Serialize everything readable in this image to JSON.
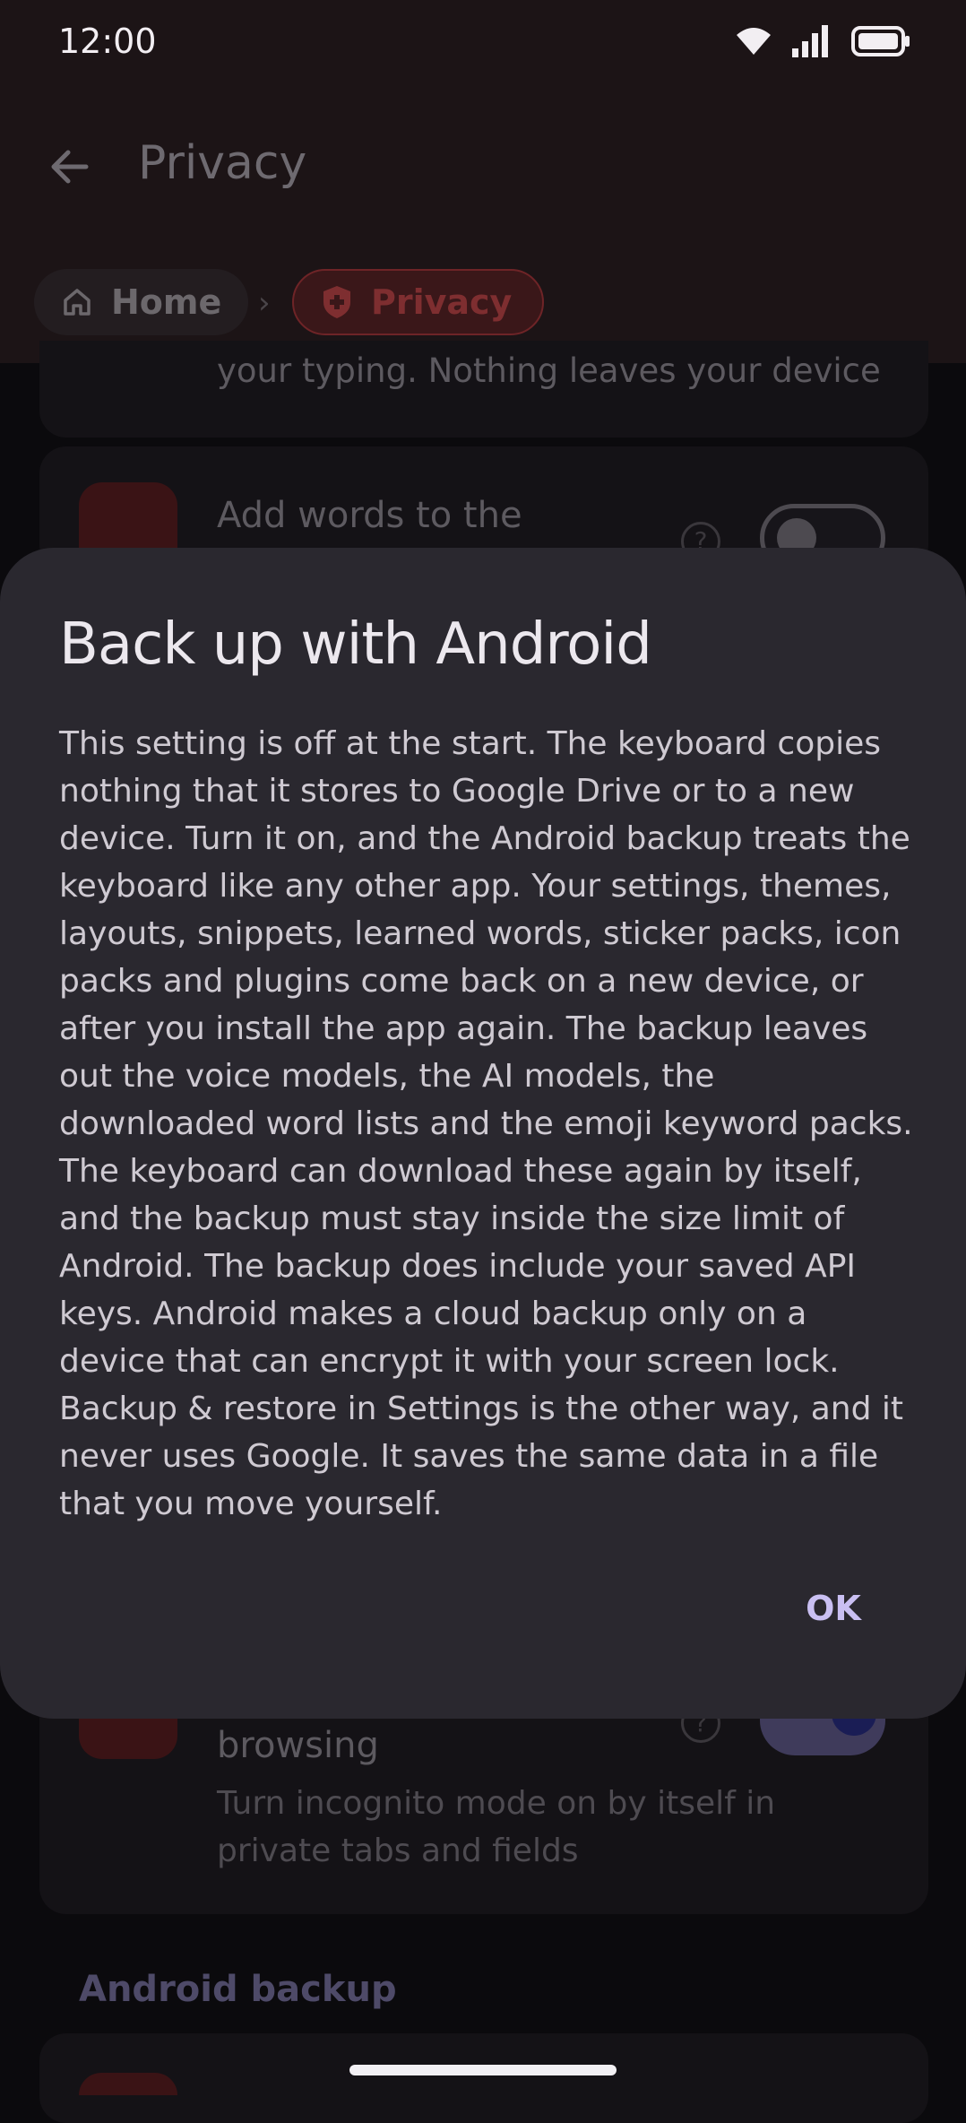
{
  "status_bar": {
    "time": "12:00"
  },
  "app_bar": {
    "title": "Privacy"
  },
  "breadcrumb": {
    "home": "Home",
    "separator": "›",
    "current": "Privacy"
  },
  "settings": {
    "card1_text": "your typing. Nothing leaves your device",
    "card2_title": "Add words to the",
    "card3_title": "browsing",
    "card3_desc": "Turn incognito mode on by itself in private tabs and fields",
    "section_header": "Android backup",
    "help_glyph": "?"
  },
  "dialog": {
    "title": "Back up with Android",
    "body": "This setting is off at the start. The keyboard copies nothing that it stores to Google Drive or to a new device. Turn it on, and the Android backup treats the keyboard like any other app. Your settings, themes, layouts, snippets, learned words, sticker packs, icon packs and plugins come back on a new device, or after you install the app again. The backup leaves out the voice models, the AI models, the downloaded word lists and the emoji keyword packs. The keyboard can download these again by itself, and the backup must stay inside the size limit of Android. The backup does include your saved API keys. Android makes a cloud backup only on a device that can encrypt it with your screen lock. Backup & restore in Settings is the other way, and it never uses Google. It saves the same data in a file that you move yourself.",
    "ok_label": "OK"
  },
  "colors": {
    "accent": "#c9bff2",
    "dialog_bg": "#2a282f",
    "privacy_red": "#7e2e30"
  }
}
